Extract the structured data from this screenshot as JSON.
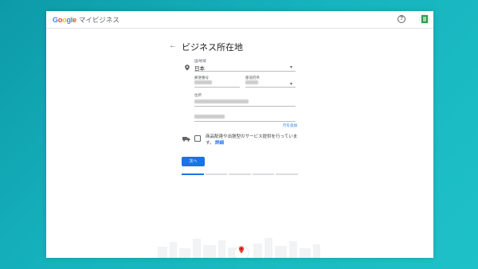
{
  "header": {
    "logo_letters": [
      "G",
      "o",
      "o",
      "g",
      "l",
      "e"
    ],
    "logo_colors": [
      "#4285F4",
      "#EA4335",
      "#FBBC05",
      "#4285F4",
      "#34A853",
      "#EA4335"
    ],
    "product_name": "マイビジネス",
    "help_symbol": "?"
  },
  "page": {
    "back_symbol": "←",
    "title": "ビジネス所在地"
  },
  "form": {
    "country_label": "国/地域",
    "country_value": "日本",
    "postal_label": "郵便番号",
    "prefecture_label": "都道府県",
    "address_label": "住所",
    "add_line_link": "行を追加",
    "delivery_text": "商品配達や出張型のサービス提供を行っています。",
    "delivery_detail_link": "詳細",
    "next_button": "次へ"
  },
  "progress": {
    "total_steps": 5,
    "current_step": 1
  },
  "colors": {
    "accent": "#1a73e8",
    "background_teal": "#16b4be",
    "map_pin": "#ea4335"
  },
  "icons": [
    "help-icon",
    "avatar",
    "back-arrow-icon",
    "location-pin-icon",
    "truck-icon",
    "chevron-down-icon",
    "map-pin-icon"
  ]
}
